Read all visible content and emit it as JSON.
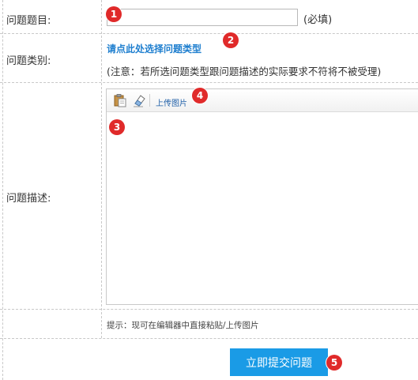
{
  "form": {
    "title_label": "问题题目:",
    "title_value": "",
    "title_required": "(必填)",
    "category_label": "问题类别:",
    "category_link": "请点此处选择问题类型",
    "category_note": "(注意：若所选问题类型跟问题描述的实际要求不符将不被受理)",
    "description_label": "问题描述:",
    "editor": {
      "toolbar": {
        "paste_icon": "paste-icon",
        "eraser_icon": "eraser-icon",
        "upload_label": "上传图片"
      },
      "content": ""
    },
    "hint": "提示：现可在编辑器中直接粘贴/上传图片",
    "submit_label": "立即提交问题"
  },
  "annotations": {
    "badge1": "1",
    "badge2": "2",
    "badge3": "3",
    "badge4": "4",
    "badge5": "5"
  },
  "colors": {
    "badge": "#e02a2a",
    "link": "#1f7fcf",
    "submit": "#1a9be6",
    "border": "#c8c8c8"
  }
}
